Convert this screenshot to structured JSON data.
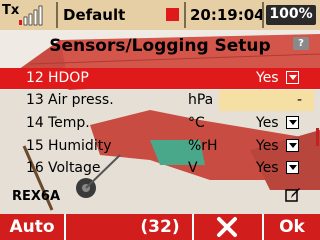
{
  "status_bar": {
    "tx_label": "Tx",
    "model_name": "Default",
    "time": "20:19:04",
    "battery": "100%",
    "signal_icon": "signal-bars-icon",
    "recording_icon": "record-square-icon",
    "colors": {
      "bar_bg": "#e6cfa4",
      "record": "#e01a1a",
      "battery_bg": "#2a2a2a"
    }
  },
  "title": "Sensors/Logging Setup",
  "help_icon": "?",
  "rows": [
    {
      "num": "12",
      "label": "HDOP",
      "unit": "",
      "value": "Yes",
      "selected": true
    },
    {
      "num": "13",
      "label": "Air press.",
      "unit": "hPa",
      "value": "-",
      "selected": false
    },
    {
      "num": "14",
      "label": "Temp.",
      "unit": "°C",
      "value": "Yes",
      "selected": false
    },
    {
      "num": "15",
      "label": "Humidity",
      "unit": "%rH",
      "value": "Yes",
      "selected": false
    },
    {
      "num": "16",
      "label": "Voltage",
      "unit": "V",
      "value": "Yes",
      "selected": false
    }
  ],
  "model_tag": "REX6A",
  "bottom_bar": {
    "auto": "Auto",
    "count": "(32)",
    "ok": "Ok",
    "cancel_icon": "close-x-icon",
    "color": "#d21d1d"
  }
}
